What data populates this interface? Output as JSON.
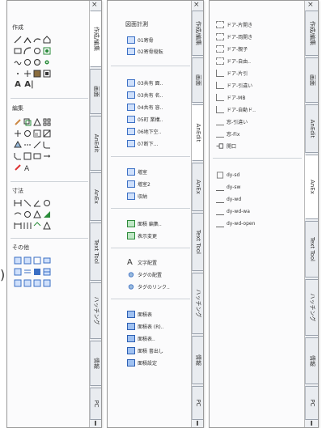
{
  "palette1": {
    "sections": [
      {
        "label": "作成"
      },
      {
        "label": "編集"
      },
      {
        "label": "寸法"
      },
      {
        "label": "その他"
      }
    ],
    "text_icon_row": [
      "A",
      "A|"
    ],
    "tabs": [
      "作成/編集",
      "画面",
      "AnEdit",
      "AnEx",
      "Text Tool",
      "ハッチング",
      "情報",
      "PC"
    ]
  },
  "palette2": {
    "header": "図面計測",
    "groups": [
      [
        "01寄骨",
        "02寄骨縦転"
      ],
      [
        "03共有 面..",
        "03共有 名..",
        "04共有 容..",
        "05町 業構..",
        "06地下空..",
        "07断下..."
      ],
      [
        "増室",
        "増室2",
        "収納"
      ],
      [
        "面積 編集..",
        "表示変更"
      ],
      [
        "文字配置",
        "タグの配置",
        "タグのリンク.."
      ],
      [
        "面積表",
        "面積表 (R)..",
        "面積表..",
        "面積 書出し",
        "面積設定"
      ]
    ],
    "group_prefix": "A",
    "tabs": [
      "作成/編集",
      "画面",
      "AnEdit",
      "AnEx",
      "Text Tool",
      "ハッチング",
      "情報",
      "PC"
    ]
  },
  "palette3": {
    "groups": [
      [
        "ドア-片開き",
        "ドア-両開き",
        "ドア-親子",
        "ドア-自由..",
        "ドア-片引",
        "ドア-引違い",
        "ドア-MB",
        "ドア-自動ド..",
        "窓-引違い",
        "窓-Fix",
        "開口"
      ],
      [
        "dy-sd",
        "dy-sw",
        "dy-wd",
        "dy-wd-wa",
        "dy-wd-open"
      ]
    ],
    "tabs": [
      "作成/編集",
      "画面",
      "AnEdit",
      "AnEx",
      "Text Tool",
      "ハッチング",
      "情報",
      "PC"
    ]
  },
  "close_glyph": "×",
  "stray_paren": ")"
}
